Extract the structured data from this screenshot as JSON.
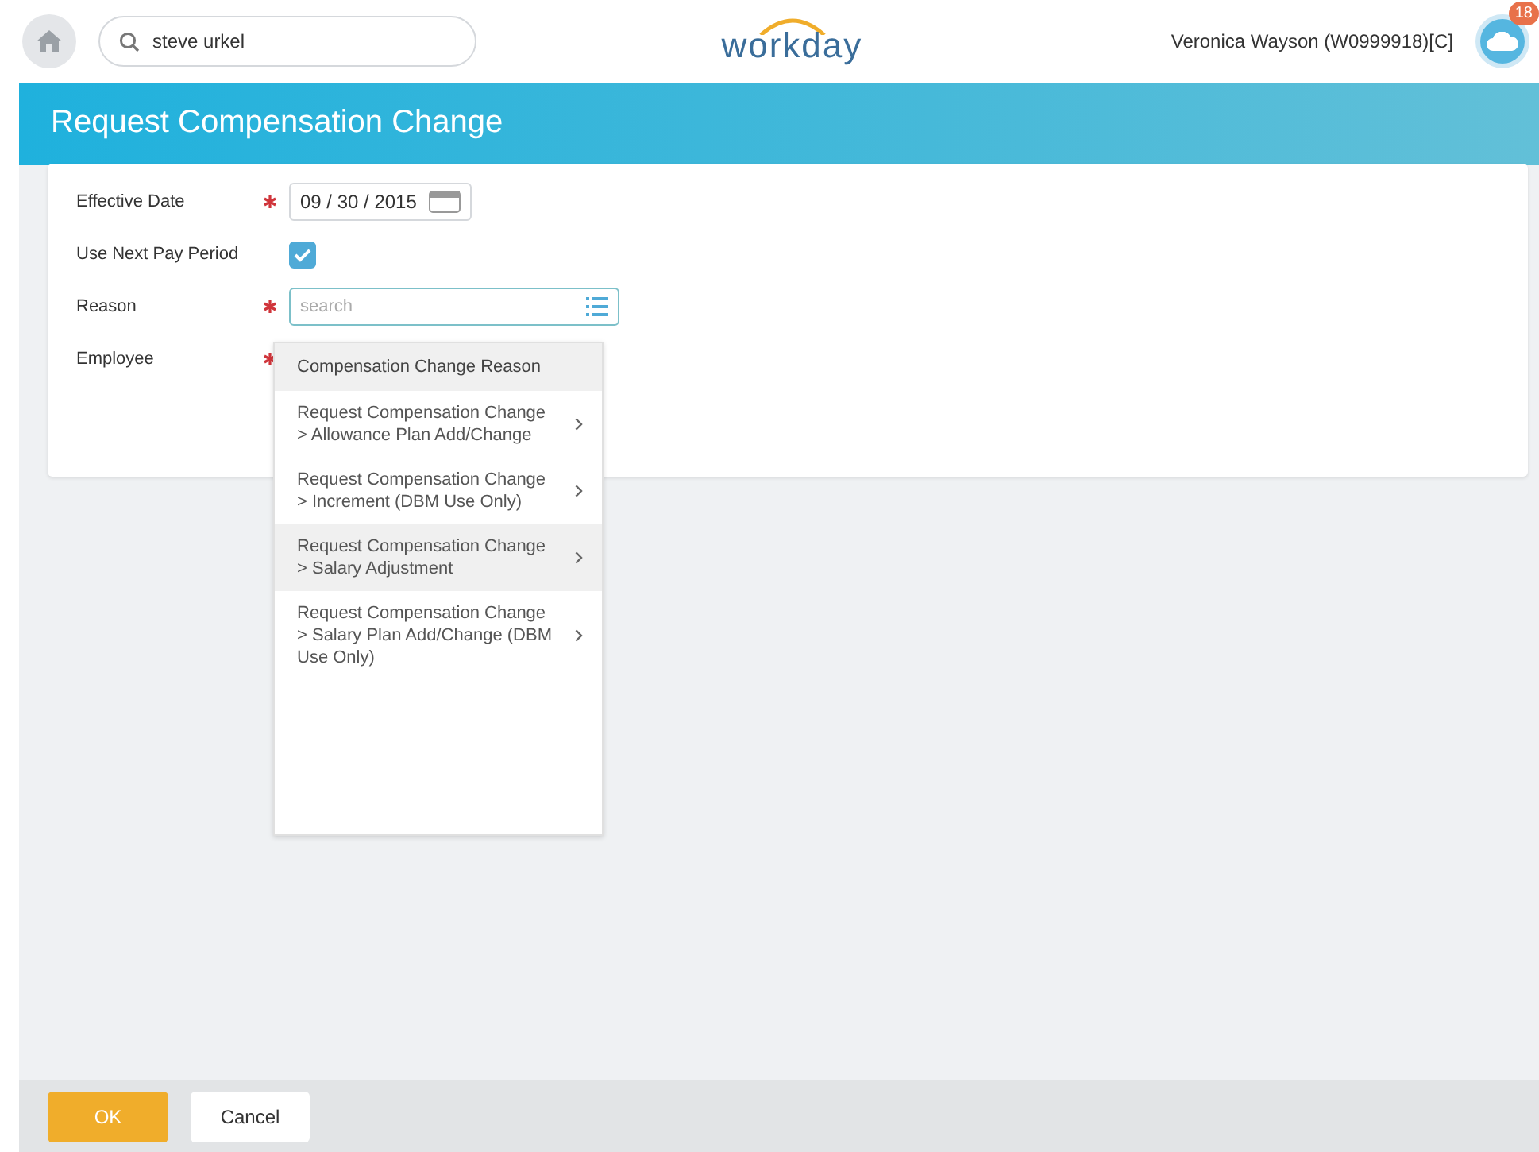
{
  "top_bar": {
    "search_value": "steve urkel",
    "logo": "workday",
    "user": "Veronica Wayson (W0999918)[C]",
    "notification_count": "18"
  },
  "page_title": "Request Compensation Change",
  "form": {
    "fields": [
      {
        "kind": "date",
        "label": "Effective Date",
        "required": true,
        "value": "09 / 30 / 2015"
      },
      {
        "kind": "checkbox",
        "label": "Use Next Pay Period",
        "required": false,
        "checked": true
      },
      {
        "kind": "prompt",
        "label": "Reason",
        "required": true,
        "placeholder": "search"
      },
      {
        "kind": "empty",
        "label": "Employee",
        "required": true
      }
    ]
  },
  "dropdown": {
    "items": [
      {
        "kind": "category",
        "label": "Compensation Change Reason"
      },
      {
        "kind": "option",
        "label": "Request Compensation Change > Allowance Plan Add/Change",
        "selected": false
      },
      {
        "kind": "option",
        "label": "Request Compensation Change > Increment (DBM Use Only)",
        "selected": false
      },
      {
        "kind": "option",
        "label": "Request Compensation Change > Salary Adjustment",
        "selected": true
      },
      {
        "kind": "option",
        "label": "Request Compensation Change > Salary Plan Add/Change (DBM Use Only)",
        "selected": false
      }
    ]
  },
  "footer": {
    "buttons": [
      {
        "kind": "primary",
        "label": "OK"
      },
      {
        "kind": "secondary",
        "label": "Cancel"
      }
    ]
  }
}
